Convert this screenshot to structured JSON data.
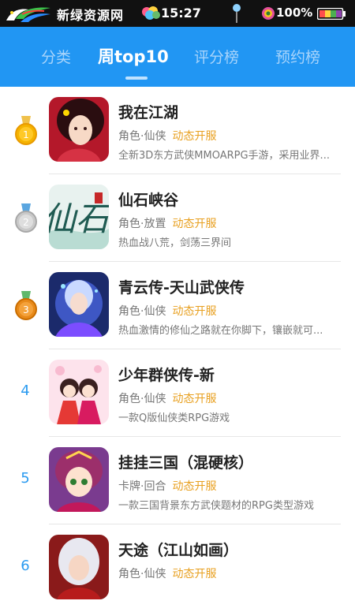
{
  "status_bar": {
    "site_name": "新绿资源网",
    "time": "15:27",
    "battery": "100%"
  },
  "tabs": [
    {
      "label": "分类",
      "active": false
    },
    {
      "label": "周top10",
      "active": true
    },
    {
      "label": "评分榜",
      "active": false
    },
    {
      "label": "预约榜",
      "active": false
    }
  ],
  "colors": {
    "accent": "#2196f3",
    "status_highlight": "#e8a020",
    "rank_text": "#2b9bf0"
  },
  "apps": [
    {
      "rank": "1",
      "medal": "gold-medal-icon",
      "name": "我在江湖",
      "category": "角色·仙侠",
      "status": "动态开服",
      "desc": "全新3D东方武侠MMOARPG手游，采用业界..."
    },
    {
      "rank": "2",
      "medal": "silver-medal-icon",
      "name": "仙石峡谷",
      "category": "角色·放置",
      "status": "动态开服",
      "desc": "热血战八荒，剑荡三界间",
      "icon_text": "仙石"
    },
    {
      "rank": "3",
      "medal": "bronze-medal-icon",
      "name": "青云传-天山武侠传",
      "category": "角色·仙侠",
      "status": "动态开服",
      "desc": "热血激情的修仙之路就在你脚下，镶嵌就可..."
    },
    {
      "rank": "4",
      "name": "少年群侠传-新",
      "category": "角色·仙侠",
      "status": "动态开服",
      "desc": "一款Q版仙侠类RPG游戏"
    },
    {
      "rank": "5",
      "name": "挂挂三国（混硬核）",
      "category": "卡牌·回合",
      "status": "动态开服",
      "desc": "一款三国背景东方武侠题材的RPG类型游戏"
    },
    {
      "rank": "6",
      "name": "天途（江山如画）",
      "category": "角色·仙侠",
      "status": "动态开服",
      "desc": ""
    }
  ]
}
